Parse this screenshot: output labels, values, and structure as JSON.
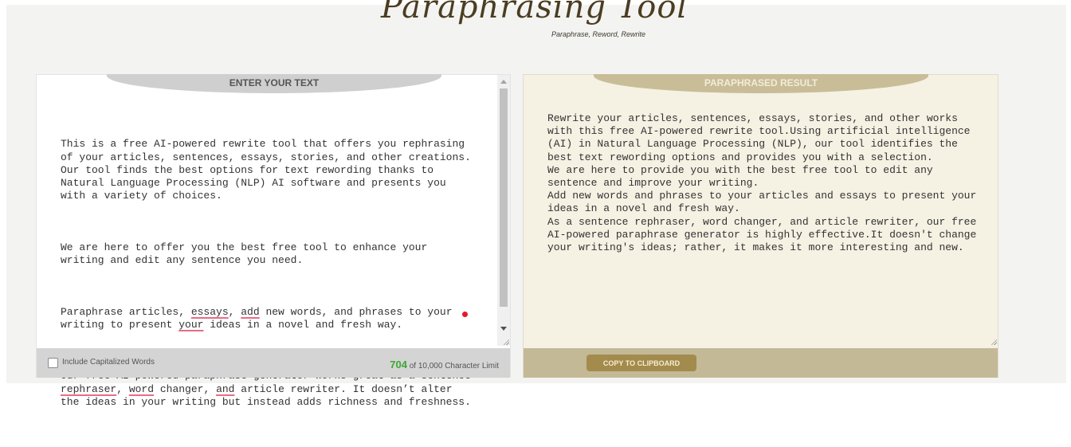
{
  "logo": {
    "title": "Paraphrasing Tool",
    "subtitle": "Paraphrase, Reword, Rewrite"
  },
  "input_panel": {
    "tab_label": "ENTER YOUR TEXT",
    "paragraphs": [
      "This is a free AI-powered rewrite tool that offers you rephrasing of your articles, sentences, essays, stories, and other creations. Our tool finds the best options for text rewording thanks to Natural Language Processing (NLP) AI software and presents you with a variety of choices.",
      "We are here to offer you the best free tool to enhance your writing and edit any sentence you need.",
      {
        "p3_a": "Paraphrase articles, ",
        "p3_w1": "essays",
        "p3_b": ", ",
        "p3_w2": "add",
        "p3_c": " new words, and phrases to your writing to present ",
        "p3_w3": "your",
        "p3_d": " ideas in a novel and fresh way."
      },
      {
        "p4_a": "Our free AI-powered paraphrase generator works great as a sentence ",
        "p4_w1": "rephraser",
        "p4_b": ", ",
        "p4_w2": "word",
        "p4_c": " changer, ",
        "p4_w3": "and",
        "p4_d": " article rewriter. It doesn’t alter the ideas in your writing but instead adds richness and freshness."
      }
    ],
    "checkbox_label": "Include Capitalized Words",
    "char_count": "704",
    "char_limit_text": " of 10,000 Character Limit"
  },
  "output_panel": {
    "tab_label": "PARAPHRASED RESULT",
    "result_text": "Rewrite your articles, sentences, essays, stories, and other works with this free AI-powered rewrite tool.Using artificial intelligence (AI) in Natural Language Processing (NLP), our tool identifies the best text rewording options and provides you with a selection.\nWe are here to provide you with the best free tool to edit any sentence and improve your writing.\nAdd new words and phrases to your articles and essays to present your ideas in a novel and fresh way.\nAs a sentence rephraser, word changer, and article rewriter, our free AI-powered paraphrase generator is highly effective.It doesn't change your writing's ideas; rather, it makes it more interesting and new.",
    "copy_button": "COPY TO CLIPBOARD"
  },
  "colors": {
    "input_tab": "#cfcfcf",
    "output_tab": "#c9bd98",
    "output_bg": "#f5f1e3",
    "copy_button": "#a28b4c",
    "char_count": "#3aa832",
    "spell_underline": "#e96b85"
  },
  "icons": {
    "scroll_up": "arrow-up-icon",
    "scroll_down": "arrow-down-icon",
    "resize": "resize-grip-icon"
  }
}
